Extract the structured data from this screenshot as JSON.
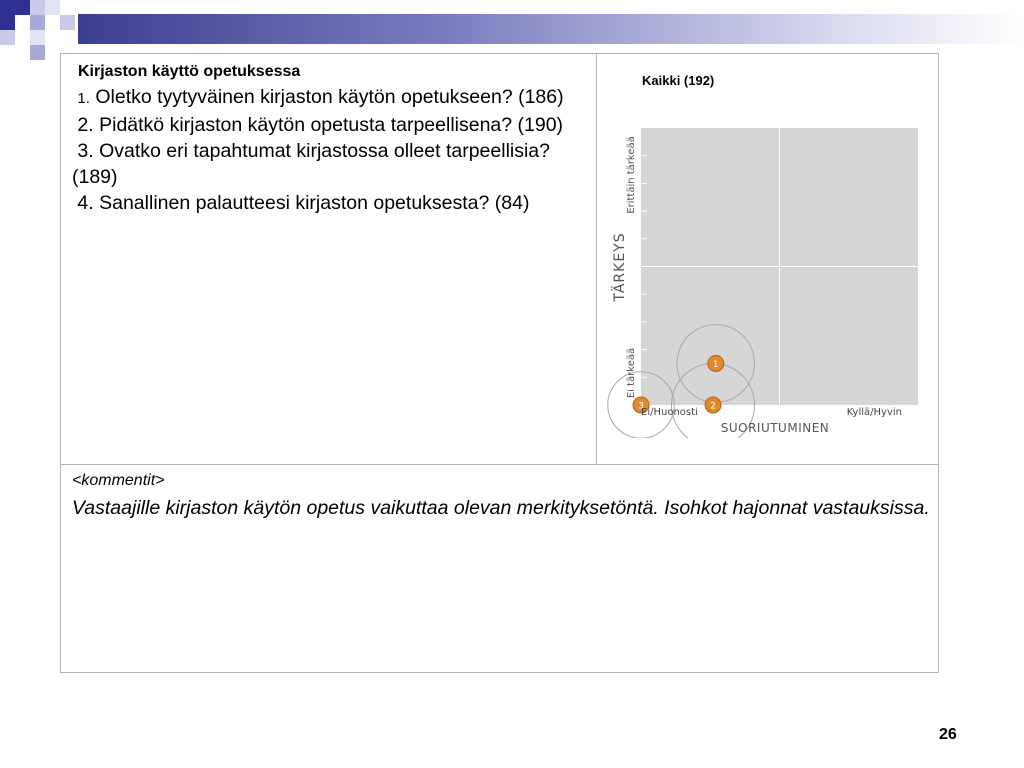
{
  "slide": {
    "questions_title": "Kirjaston käyttö opetuksessa",
    "questions": [
      {
        "num": "1.",
        "text": "Oletko tyytyväinen kirjaston käytön opetukseen? (186)"
      },
      {
        "num": "2.",
        "text": "Pidätkö kirjaston käytön opetusta tarpeellisena? (190)"
      },
      {
        "num": "3.",
        "text": "Ovatko eri tapahtumat kirjastossa olleet tarpeellisia? (189)"
      },
      {
        "num": "4.",
        "text": "Sanallinen palautteesi kirjaston opetuksesta? (84)"
      }
    ],
    "comment_heading": "<kommentit>",
    "comment_text": "Vastaajille kirjaston käytön opetus vaikuttaa olevan merkityksetöntä. Isohkot hajonnat vastauksissa.",
    "page_number": "26"
  },
  "chart_data": {
    "type": "scatter",
    "title": "Kaikki (192)",
    "xlabel": "SUORIUTUMINEN",
    "ylabel": "TÄRKEYS",
    "x_low_label": "Ei/Huonosti",
    "x_high_label": "Kyllä/Hyvin",
    "y_low_label": "Ei tärkeää",
    "y_high_label": "Erittäin tärkeää",
    "xlim": [
      0,
      1
    ],
    "ylim": [
      0,
      1
    ],
    "grid": true,
    "points": [
      {
        "label": "1",
        "x": 0.27,
        "y": 0.15,
        "spread": 0.14
      },
      {
        "label": "2",
        "x": 0.26,
        "y": 0.0,
        "spread": 0.15
      },
      {
        "label": "3",
        "x": 0.0,
        "y": 0.0,
        "spread": 0.12
      }
    ],
    "colors": {
      "plot_bg": "#d6d6d6",
      "marker": "#e08a2c",
      "spread_ring": "#a8a8a8"
    }
  }
}
